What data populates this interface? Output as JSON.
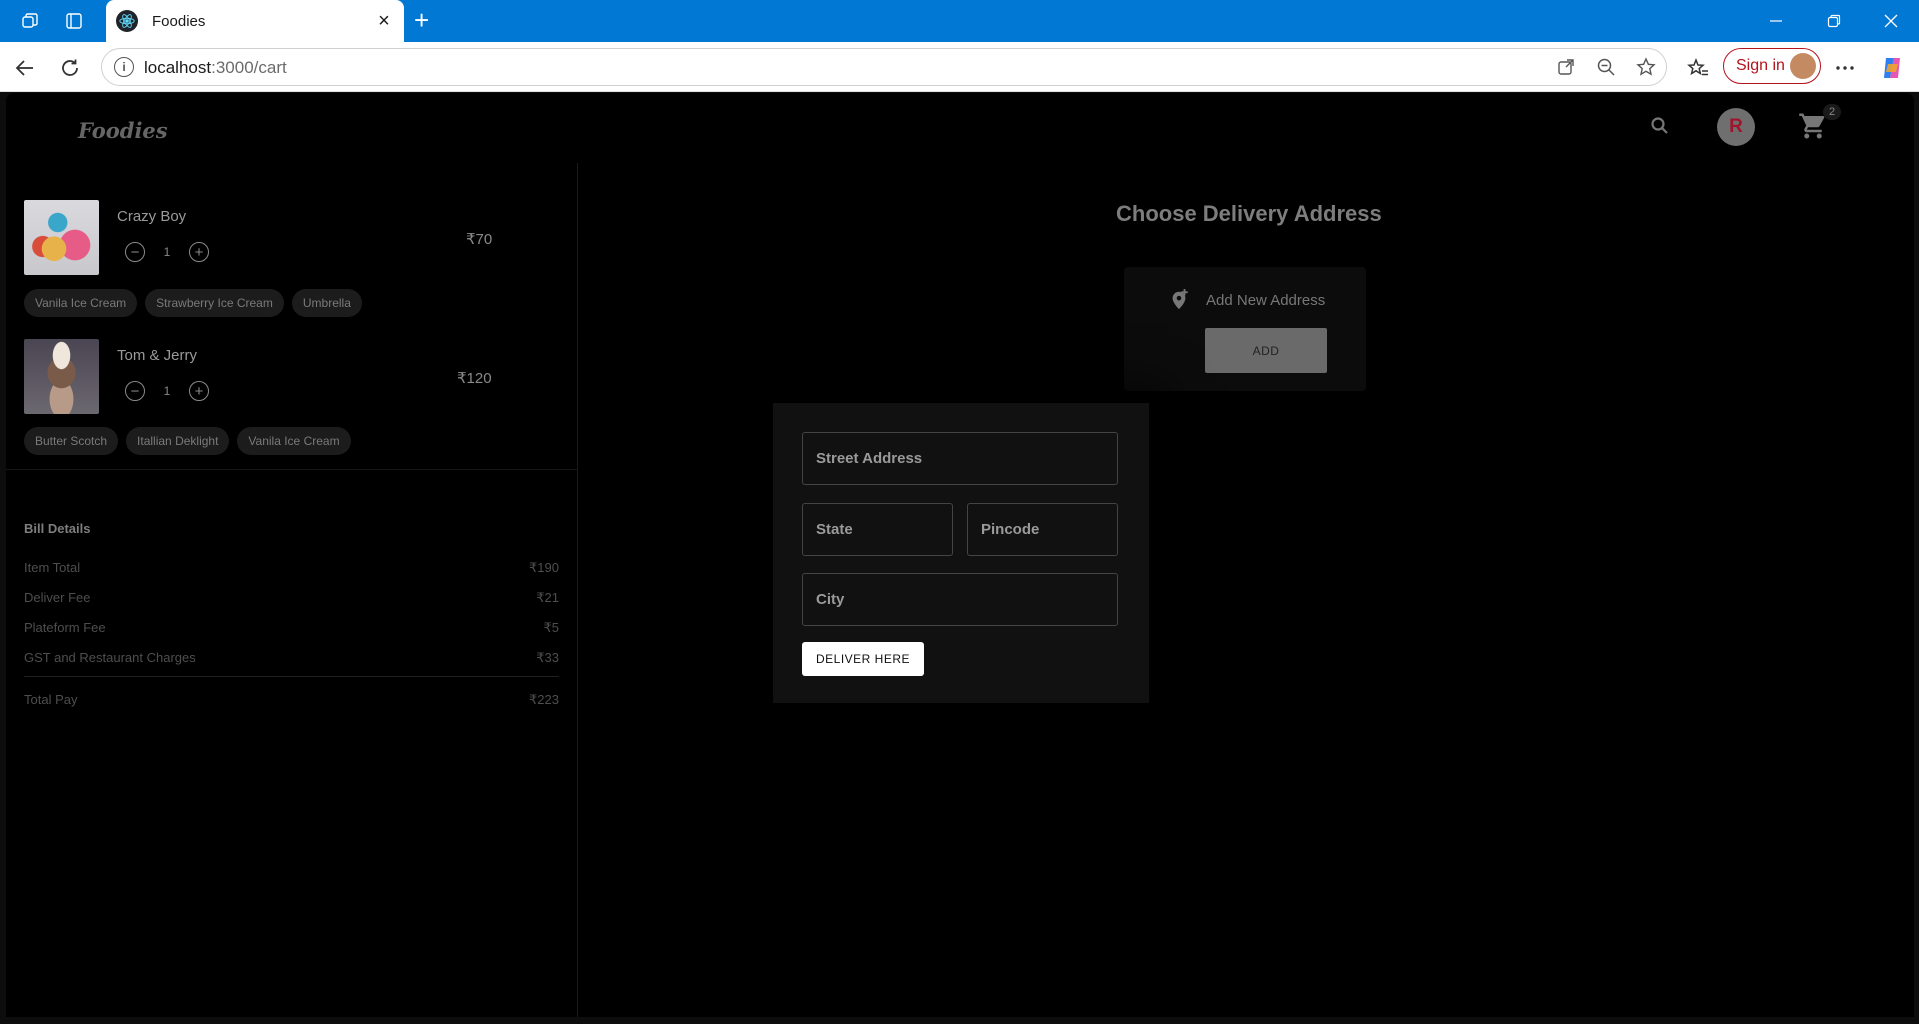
{
  "browser": {
    "tab_title": "Foodies",
    "tab_close": "×",
    "new_tab": "+",
    "url_host": "localhost",
    "url_rest": ":3000/cart",
    "signin_label": "Sign in"
  },
  "header": {
    "logo": "Foodies",
    "avatar_initial": "R",
    "cart_count": "2"
  },
  "cart": {
    "items": [
      {
        "name": "Crazy Boy",
        "quantity": "1",
        "price": "₹70",
        "addons": [
          "Vanila Ice Cream",
          "Strawberry Ice Cream",
          "Umbrella"
        ]
      },
      {
        "name": "Tom & Jerry",
        "quantity": "1",
        "price": "₹120",
        "addons": [
          "Butter Scotch",
          "Itallian Deklight",
          "Vanila Ice Cream"
        ]
      }
    ],
    "qty_minus": "−",
    "qty_plus": "+"
  },
  "bill": {
    "title": "Bill Details",
    "rows": [
      {
        "label": "Item Total",
        "value": "₹190"
      },
      {
        "label": "Deliver Fee",
        "value": "₹21"
      },
      {
        "label": "Plateform Fee",
        "value": "₹5"
      },
      {
        "label": "GST and Restaurant Charges",
        "value": "₹33"
      }
    ],
    "total": {
      "label": "Total Pay",
      "value": "₹223"
    }
  },
  "delivery": {
    "title": "Choose Delivery Address",
    "add_new_label": "Add New Address",
    "add_button": "ADD",
    "form": {
      "street_placeholder": "Street Address",
      "state_placeholder": "State",
      "pincode_placeholder": "Pincode",
      "city_placeholder": "City",
      "submit_label": "DELIVER HERE"
    }
  }
}
